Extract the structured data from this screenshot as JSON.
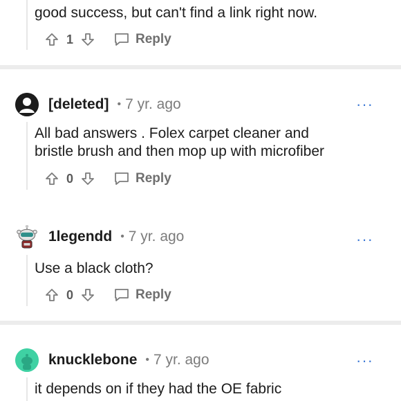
{
  "comments": [
    {
      "text": "good success, but can't find a link right now.",
      "votes": "1",
      "reply_label": "Reply"
    },
    {
      "username": "[deleted]",
      "separator_dot": "•",
      "time": "7 yr. ago",
      "more_label": "···",
      "text_lines": [
        "All bad answers . Folex carpet cleaner and",
        "bristle brush and then mop up with microfiber"
      ],
      "votes": "0",
      "reply_label": "Reply"
    },
    {
      "username": "1legendd",
      "separator_dot": "•",
      "time": "7 yr. ago",
      "more_label": "···",
      "text_lines": [
        "Use a black cloth?"
      ],
      "votes": "0",
      "reply_label": "Reply"
    },
    {
      "username": "knucklebone",
      "separator_dot": "•",
      "time": "7 yr. ago",
      "more_label": "···",
      "text_lines": [
        "it depends on if they had the OE fabric"
      ]
    }
  ],
  "colors": {
    "accent_more": "#3e7ad6",
    "avatar_knucklebone": "#3fd1a3",
    "separator": "#ececec"
  },
  "icons": [
    "upvote-icon",
    "downvote-icon",
    "reply-icon",
    "avatar-deleted-icon",
    "avatar-snoo-icon"
  ]
}
